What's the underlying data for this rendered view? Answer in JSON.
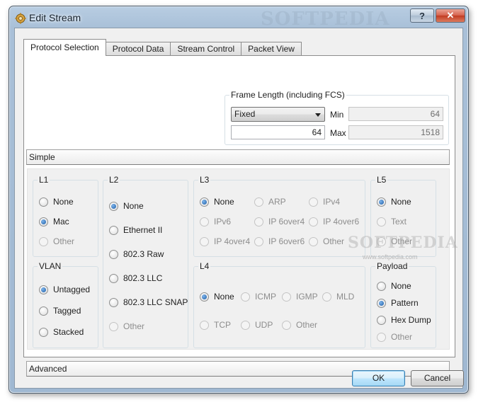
{
  "window": {
    "title": "Edit Stream",
    "watermark": "SOFTPEDIA",
    "help_label": "?",
    "close_label": "✕"
  },
  "tabs": [
    {
      "label": "Protocol Selection",
      "active": true
    },
    {
      "label": "Protocol Data",
      "active": false
    },
    {
      "label": "Stream Control",
      "active": false
    },
    {
      "label": "Packet View",
      "active": false
    }
  ],
  "frame_length": {
    "title": "Frame Length (including FCS)",
    "mode": "Fixed",
    "value": "64",
    "min_label": "Min",
    "min_value": "64",
    "max_label": "Max",
    "max_value": "1518"
  },
  "sections": {
    "simple": "Simple",
    "advanced": "Advanced"
  },
  "groups": {
    "l1": {
      "title": "L1",
      "options": [
        {
          "label": "None"
        },
        {
          "label": "Mac"
        },
        {
          "label": "Other"
        }
      ],
      "selected": "Mac"
    },
    "vlan": {
      "title": "VLAN",
      "options": [
        {
          "label": "Untagged"
        },
        {
          "label": "Tagged"
        },
        {
          "label": "Stacked"
        }
      ],
      "selected": "Untagged"
    },
    "l2": {
      "title": "L2",
      "options": [
        {
          "label": "None"
        },
        {
          "label": "Ethernet II"
        },
        {
          "label": "802.3 Raw"
        },
        {
          "label": "802.3 LLC"
        },
        {
          "label": "802.3 LLC SNAP"
        },
        {
          "label": "Other"
        }
      ],
      "selected": "None"
    },
    "l3": {
      "title": "L3",
      "options": [
        {
          "label": "None"
        },
        {
          "label": "ARP"
        },
        {
          "label": "IPv4"
        },
        {
          "label": "IPv6"
        },
        {
          "label": "IP 6over4"
        },
        {
          "label": "IP 4over6"
        },
        {
          "label": "IP 4over4"
        },
        {
          "label": "IP 6over6"
        },
        {
          "label": "Other"
        }
      ],
      "selected": "None"
    },
    "l4": {
      "title": "L4",
      "options": [
        {
          "label": "None"
        },
        {
          "label": "ICMP"
        },
        {
          "label": "IGMP"
        },
        {
          "label": "MLD"
        },
        {
          "label": "TCP"
        },
        {
          "label": "UDP"
        },
        {
          "label": "Other"
        }
      ],
      "selected": "None"
    },
    "l5": {
      "title": "L5",
      "options": [
        {
          "label": "None"
        },
        {
          "label": "Text"
        },
        {
          "label": "Other"
        }
      ],
      "selected": "None"
    },
    "payload": {
      "title": "Payload",
      "options": [
        {
          "label": "None"
        },
        {
          "label": "Pattern"
        },
        {
          "label": "Hex Dump"
        },
        {
          "label": "Other"
        }
      ],
      "selected": "Pattern"
    }
  },
  "watermark": {
    "text": "SOFTPEDIA",
    "url": "www.softpedia.com"
  },
  "buttons": {
    "ok": "OK",
    "cancel": "Cancel"
  }
}
